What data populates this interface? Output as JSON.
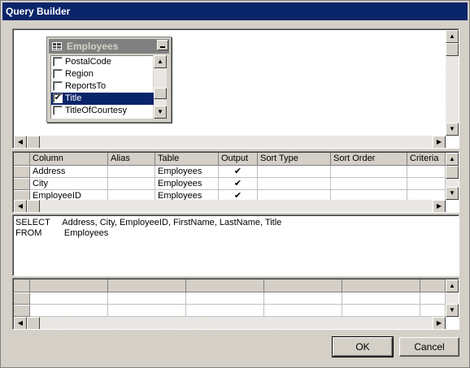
{
  "window": {
    "title": "Query Builder"
  },
  "table_window": {
    "title": "Employees",
    "fields": [
      {
        "name": "PostalCode",
        "checked": false,
        "selected": false
      },
      {
        "name": "Region",
        "checked": false,
        "selected": false
      },
      {
        "name": "ReportsTo",
        "checked": false,
        "selected": false
      },
      {
        "name": "Title",
        "checked": true,
        "selected": true
      },
      {
        "name": "TitleOfCourtesy",
        "checked": false,
        "selected": false
      }
    ]
  },
  "criteria_grid": {
    "columns": [
      "Column",
      "Alias",
      "Table",
      "Output",
      "Sort Type",
      "Sort Order",
      "Criteria"
    ],
    "rows": [
      {
        "column": "Address",
        "alias": "",
        "table": "Employees",
        "output": "✔",
        "sort_type": "",
        "sort_order": "",
        "criteria": ""
      },
      {
        "column": "City",
        "alias": "",
        "table": "Employees",
        "output": "✔",
        "sort_type": "",
        "sort_order": "",
        "criteria": ""
      },
      {
        "column": "EmployeeID",
        "alias": "",
        "table": "Employees",
        "output": "✔",
        "sort_type": "",
        "sort_order": "",
        "criteria": ""
      }
    ]
  },
  "sql": {
    "line1": "SELECT     Address, City, EmployeeID, FirstName, LastName, Title",
    "line2": "FROM         Employees"
  },
  "buttons": {
    "ok": "OK",
    "cancel": "Cancel"
  },
  "icons": {
    "scroll_up": "▲",
    "scroll_down": "▼",
    "scroll_left": "◀",
    "scroll_right": "▶",
    "check": "✔"
  }
}
